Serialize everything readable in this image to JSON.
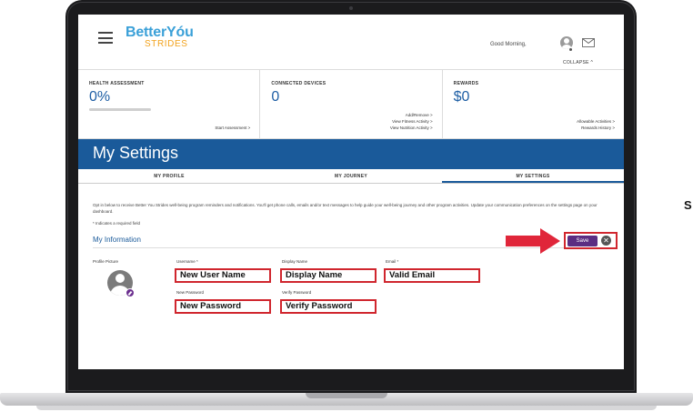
{
  "app": {
    "logo_top": "BetterYóu",
    "logo_bottom": "STRIDES"
  },
  "header": {
    "greeting": "Good Morning,",
    "collapse_label": "COLLAPSE ^"
  },
  "stats": {
    "health": {
      "title": "HEALTH ASSESSMENT",
      "value": "0%",
      "progress_percent": 0,
      "links": [
        "Start Assessment >"
      ]
    },
    "devices": {
      "title": "CONNECTED DEVICES",
      "value": "0",
      "links": [
        "Add/Remove >",
        "View Fitness Activity >",
        "View Nutrition Activity >"
      ]
    },
    "rewards": {
      "title": "REWARDS",
      "value": "$0",
      "links": [
        "Allowable Activities >",
        "Rewards History >"
      ]
    }
  },
  "page": {
    "title": "My Settings",
    "tabs": [
      {
        "label": "MY PROFILE",
        "active": false
      },
      {
        "label": "MY JOURNEY",
        "active": false
      },
      {
        "label": "MY SETTINGS",
        "active": true
      }
    ]
  },
  "settings": {
    "intro": "Opt in below to receive Better You Strides well-being program reminders and notifications. You'll get phone calls, emails and/or text messages to help guide your well-being journey and other program activities. Update your communication preferences on the settings page on your dashboard.",
    "required_note": "* Indicates a required field",
    "section_title": "My Information",
    "save_label": "Save",
    "close_glyph": "✕",
    "profile_picture_label": "Profile Picture",
    "fields": {
      "username": {
        "label": "Username *",
        "value": "New User Name"
      },
      "display_name": {
        "label": "Display Name",
        "value": "Display Name"
      },
      "email": {
        "label": "Email *",
        "value": "Valid Email"
      },
      "new_password": {
        "label": "New Password",
        "value": "New Password"
      },
      "verify_password": {
        "label": "Verify Password",
        "value": "Verify Password"
      }
    }
  },
  "side_text": "S",
  "colors": {
    "brand_blue": "#1a5a9a",
    "logo_blue": "#3aa0d8",
    "logo_orange": "#f2a21c",
    "highlight_red": "#d0262e",
    "save_purple": "#5b2d82"
  }
}
